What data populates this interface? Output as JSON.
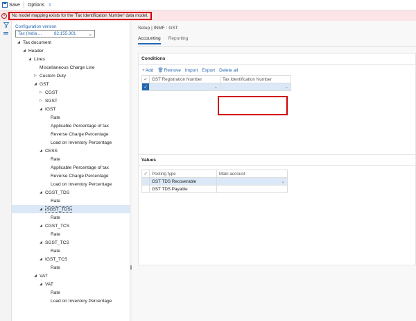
{
  "toolbar": {
    "save_label": "Save",
    "options_label": "Options"
  },
  "error": {
    "message": "No model mapping exists for the 'Tax Identification Number' data model."
  },
  "config": {
    "label": "Configuration version",
    "name_value": "Tax (India ...",
    "version_value": "82.155.301"
  },
  "tree": [
    {
      "label": "Tax document",
      "level": 0,
      "toggle": "down"
    },
    {
      "label": "Header",
      "level": 1,
      "toggle": "down"
    },
    {
      "label": "Lines",
      "level": 2,
      "toggle": "down"
    },
    {
      "label": "Miscellaneous Charge Line",
      "level": 3,
      "toggle": "none"
    },
    {
      "label": "Custom Duty",
      "level": 3,
      "toggle": "right"
    },
    {
      "label": "GST",
      "level": 3,
      "toggle": "down"
    },
    {
      "label": "CGST",
      "level": 4,
      "toggle": "right"
    },
    {
      "label": "SGST",
      "level": 4,
      "toggle": "right"
    },
    {
      "label": "IGST",
      "level": 4,
      "toggle": "down"
    },
    {
      "label": "Rate",
      "level": 5,
      "toggle": "none"
    },
    {
      "label": "Applicable Percentage of tax",
      "level": 5,
      "toggle": "none"
    },
    {
      "label": "Reverse Charge Percentage",
      "level": 5,
      "toggle": "none"
    },
    {
      "label": "Load on Inventory Percentage",
      "level": 5,
      "toggle": "none"
    },
    {
      "label": "CESS",
      "level": 4,
      "toggle": "down"
    },
    {
      "label": "Rate",
      "level": 5,
      "toggle": "none"
    },
    {
      "label": "Applicable Percentage of tax",
      "level": 5,
      "toggle": "none"
    },
    {
      "label": "Reverse Charge Percentage",
      "level": 5,
      "toggle": "none"
    },
    {
      "label": "Load on Inventory Percentage",
      "level": 5,
      "toggle": "none"
    },
    {
      "label": "CGST_TDS",
      "level": 4,
      "toggle": "down"
    },
    {
      "label": "Rate",
      "level": 5,
      "toggle": "none"
    },
    {
      "label": "SGST_TDS",
      "level": 4,
      "toggle": "down",
      "selected": true
    },
    {
      "label": "Rate",
      "level": 5,
      "toggle": "none"
    },
    {
      "label": "CGST_TCS",
      "level": 4,
      "toggle": "down"
    },
    {
      "label": "Rate",
      "level": 5,
      "toggle": "none"
    },
    {
      "label": "SGST_TCS",
      "level": 4,
      "toggle": "down"
    },
    {
      "label": "Rate",
      "level": 5,
      "toggle": "none"
    },
    {
      "label": "IGST_TCS",
      "level": 4,
      "toggle": "down"
    },
    {
      "label": "Rate",
      "level": 5,
      "toggle": "none"
    },
    {
      "label": "VAT",
      "level": 3,
      "toggle": "down"
    },
    {
      "label": "VAT",
      "level": 4,
      "toggle": "down"
    },
    {
      "label": "Rate",
      "level": 5,
      "toggle": "none"
    },
    {
      "label": "Load on Inventory Percentage",
      "level": 5,
      "toggle": "none"
    }
  ],
  "main": {
    "breadcrumb": "Setup  |  INMF : GST",
    "tabs": [
      {
        "label": "Accounting",
        "active": true
      },
      {
        "label": "Reporting",
        "active": false
      }
    ]
  },
  "conditions": {
    "title": "Conditions",
    "actions": {
      "add": "Add",
      "remove": "Remove",
      "import": "Import",
      "export": "Export",
      "delete_all": "Delete all"
    },
    "columns": [
      "GST Registration Number",
      "Tax Identification Number"
    ],
    "rows": [
      {
        "gst_reg": "",
        "tax_id": ""
      }
    ]
  },
  "values": {
    "title": "Values",
    "columns": [
      "Posting type",
      "Main account"
    ],
    "rows": [
      {
        "posting_type": "GST TDS Recoverable",
        "main_account": ""
      },
      {
        "posting_type": "GST TDS Payable",
        "main_account": ""
      }
    ]
  },
  "icons": {
    "save": "save-icon",
    "search": "search-icon",
    "error": "error-icon",
    "filter": "filter-icon",
    "list": "list-icon",
    "add": "add-icon",
    "remove": "delete-icon",
    "dropdown": "chevron-down-icon"
  },
  "colors": {
    "accent": "#2266b0",
    "error_bg": "#fbe5e6",
    "highlight_box": "#d00000",
    "selection": "#dbe8f7"
  }
}
